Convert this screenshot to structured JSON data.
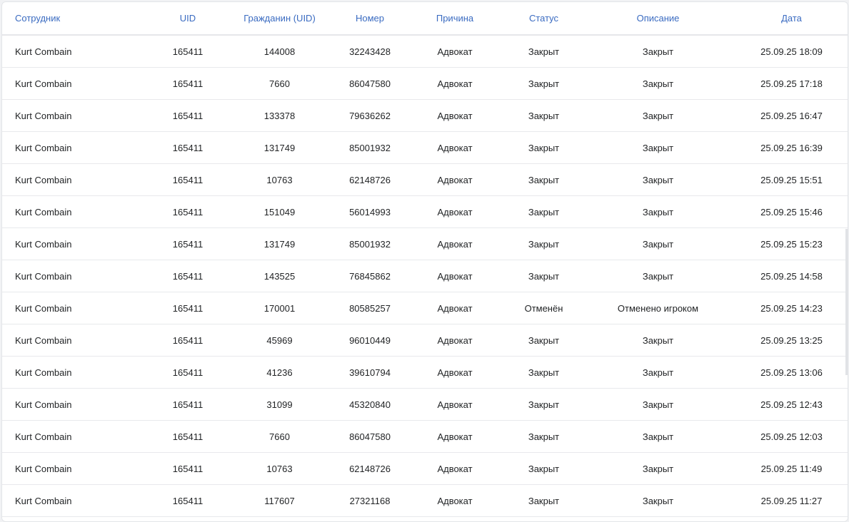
{
  "table": {
    "columns": [
      "Сотрудник",
      "UID",
      "Гражданин (UID)",
      "Номер",
      "Причина",
      "Статус",
      "Описание",
      "Дата"
    ],
    "rows": [
      [
        "Kurt Combain",
        "165411",
        "144008",
        "32243428",
        "Адвокат",
        "Закрыт",
        "Закрыт",
        "25.09.25 18:09"
      ],
      [
        "Kurt Combain",
        "165411",
        "7660",
        "86047580",
        "Адвокат",
        "Закрыт",
        "Закрыт",
        "25.09.25 17:18"
      ],
      [
        "Kurt Combain",
        "165411",
        "133378",
        "79636262",
        "Адвокат",
        "Закрыт",
        "Закрыт",
        "25.09.25 16:47"
      ],
      [
        "Kurt Combain",
        "165411",
        "131749",
        "85001932",
        "Адвокат",
        "Закрыт",
        "Закрыт",
        "25.09.25 16:39"
      ],
      [
        "Kurt Combain",
        "165411",
        "10763",
        "62148726",
        "Адвокат",
        "Закрыт",
        "Закрыт",
        "25.09.25 15:51"
      ],
      [
        "Kurt Combain",
        "165411",
        "151049",
        "56014993",
        "Адвокат",
        "Закрыт",
        "Закрыт",
        "25.09.25 15:46"
      ],
      [
        "Kurt Combain",
        "165411",
        "131749",
        "85001932",
        "Адвокат",
        "Закрыт",
        "Закрыт",
        "25.09.25 15:23"
      ],
      [
        "Kurt Combain",
        "165411",
        "143525",
        "76845862",
        "Адвокат",
        "Закрыт",
        "Закрыт",
        "25.09.25 14:58"
      ],
      [
        "Kurt Combain",
        "165411",
        "170001",
        "80585257",
        "Адвокат",
        "Отменён",
        "Отменено игроком",
        "25.09.25 14:23"
      ],
      [
        "Kurt Combain",
        "165411",
        "45969",
        "96010449",
        "Адвокат",
        "Закрыт",
        "Закрыт",
        "25.09.25 13:25"
      ],
      [
        "Kurt Combain",
        "165411",
        "41236",
        "39610794",
        "Адвокат",
        "Закрыт",
        "Закрыт",
        "25.09.25 13:06"
      ],
      [
        "Kurt Combain",
        "165411",
        "31099",
        "45320840",
        "Адвокат",
        "Закрыт",
        "Закрыт",
        "25.09.25 12:43"
      ],
      [
        "Kurt Combain",
        "165411",
        "7660",
        "86047580",
        "Адвокат",
        "Закрыт",
        "Закрыт",
        "25.09.25 12:03"
      ],
      [
        "Kurt Combain",
        "165411",
        "10763",
        "62148726",
        "Адвокат",
        "Закрыт",
        "Закрыт",
        "25.09.25 11:49"
      ],
      [
        "Kurt Combain",
        "165411",
        "117607",
        "27321168",
        "Адвокат",
        "Закрыт",
        "Закрыт",
        "25.09.25 11:27"
      ]
    ]
  },
  "colors": {
    "header_text": "#3a6bc1",
    "cell_text": "#222426",
    "row_border": "#e8e9ec"
  }
}
